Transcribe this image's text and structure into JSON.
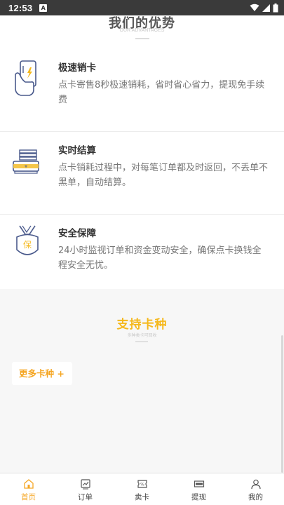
{
  "status_bar": {
    "time": "12:53",
    "notification_badge": "A"
  },
  "advantages": {
    "title": "我们的优势",
    "subtitle": "OUR ADVANTAGES",
    "items": [
      {
        "icon": "fast-card-icon",
        "title": "极速销卡",
        "desc": "点卡寄售8秒极速销耗，省时省心省力，提现免手续费"
      },
      {
        "icon": "settlement-icon",
        "title": "实时结算",
        "desc": "点卡销耗过程中，对每笔订单都及时返回，不丢单不黑单，自动结算。"
      },
      {
        "icon": "security-badge-icon",
        "title": "安全保障",
        "desc": "24小时监视订单和资金变动安全，确保点卡换钱全程安全无忧。"
      }
    ]
  },
  "support": {
    "title": "支持卡种",
    "subtitle": "多种类卡可回收",
    "more_label": "更多卡种 +"
  },
  "tabbar": {
    "items": [
      {
        "label": "首页",
        "icon": "home-icon",
        "active": true
      },
      {
        "label": "订单",
        "icon": "chart-icon",
        "active": false
      },
      {
        "label": "卖卡",
        "icon": "ticket-percent-icon",
        "active": false
      },
      {
        "label": "提现",
        "icon": "cash-icon",
        "active": false
      },
      {
        "label": "我的",
        "icon": "user-icon",
        "active": false
      }
    ]
  },
  "colors": {
    "accent": "#f5a623",
    "support_title": "#f5b81c",
    "status_bar": "#3a3a3a",
    "icon_stroke": "#4a5a8c"
  }
}
